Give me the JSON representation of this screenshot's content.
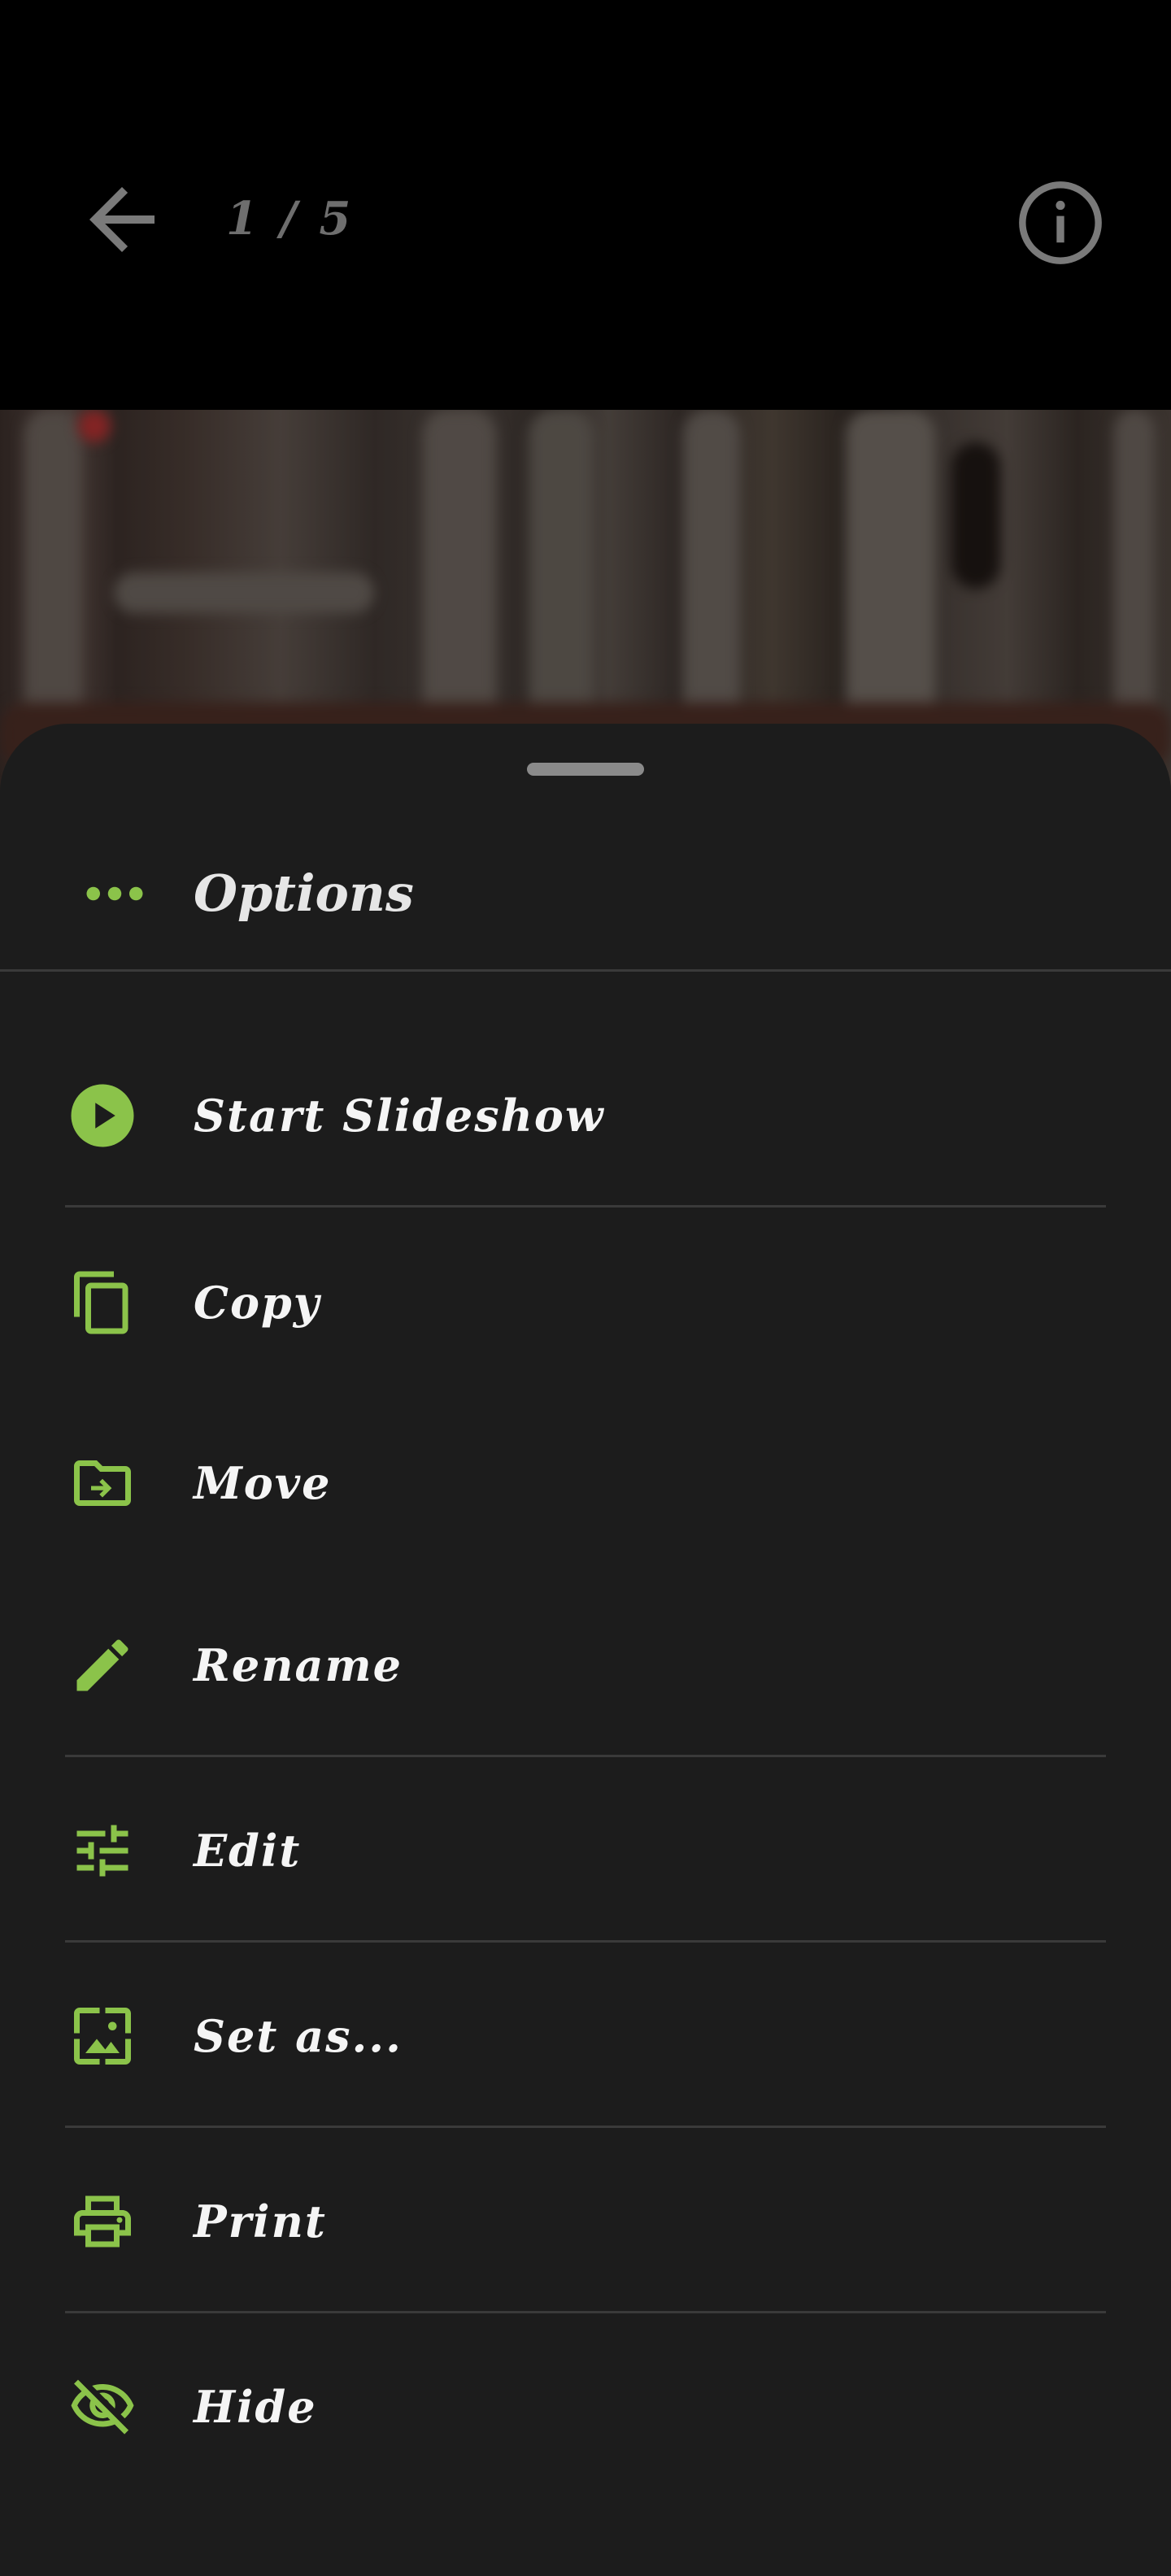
{
  "colors": {
    "accent": "#8bc34a",
    "background": "#000000",
    "sheet": "#1c1c1c",
    "text": "#f5f5f5",
    "muted": "#6e6e6e"
  },
  "topbar": {
    "counter": "1 / 5",
    "back_icon": "arrow-back-icon",
    "info_icon": "info-icon"
  },
  "sheet": {
    "header_icon": "more-horizontal-icon",
    "title": "Options",
    "items": [
      {
        "label": "Start Slideshow",
        "icon": "play-circle-icon"
      },
      {
        "label": "Copy",
        "icon": "copy-icon"
      },
      {
        "label": "Move",
        "icon": "folder-move-icon"
      },
      {
        "label": "Rename",
        "icon": "pencil-icon"
      },
      {
        "label": "Edit",
        "icon": "tune-sliders-icon"
      },
      {
        "label": "Set as...",
        "icon": "wallpaper-icon"
      },
      {
        "label": "Print",
        "icon": "printer-icon"
      },
      {
        "label": "Hide",
        "icon": "eye-off-icon"
      }
    ]
  }
}
